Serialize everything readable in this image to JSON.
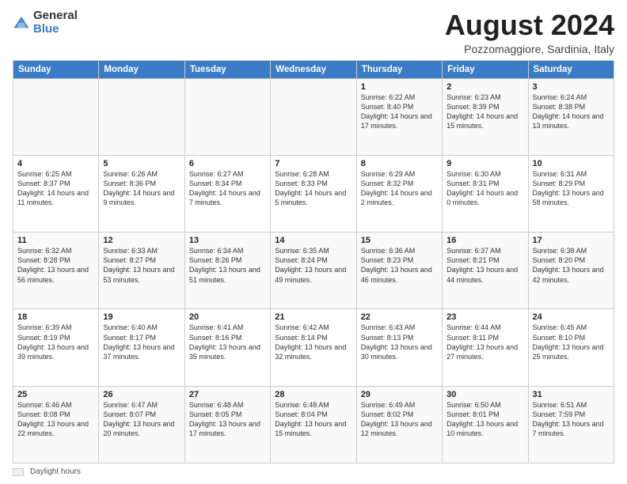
{
  "header": {
    "logo_general": "General",
    "logo_blue": "Blue",
    "month_title": "August 2024",
    "location": "Pozzomaggiore, Sardinia, Italy"
  },
  "footer": {
    "legend_label": "Daylight hours"
  },
  "days_of_week": [
    "Sunday",
    "Monday",
    "Tuesday",
    "Wednesday",
    "Thursday",
    "Friday",
    "Saturday"
  ],
  "weeks": [
    {
      "days": [
        {
          "num": "",
          "info": "",
          "empty": true
        },
        {
          "num": "",
          "info": "",
          "empty": true
        },
        {
          "num": "",
          "info": "",
          "empty": true
        },
        {
          "num": "",
          "info": "",
          "empty": true
        },
        {
          "num": "1",
          "info": "Sunrise: 6:22 AM\nSunset: 8:40 PM\nDaylight: 14 hours and 17 minutes."
        },
        {
          "num": "2",
          "info": "Sunrise: 6:23 AM\nSunset: 8:39 PM\nDaylight: 14 hours and 15 minutes."
        },
        {
          "num": "3",
          "info": "Sunrise: 6:24 AM\nSunset: 8:38 PM\nDaylight: 14 hours and 13 minutes."
        }
      ]
    },
    {
      "days": [
        {
          "num": "4",
          "info": "Sunrise: 6:25 AM\nSunset: 8:37 PM\nDaylight: 14 hours and 11 minutes."
        },
        {
          "num": "5",
          "info": "Sunrise: 6:26 AM\nSunset: 8:36 PM\nDaylight: 14 hours and 9 minutes."
        },
        {
          "num": "6",
          "info": "Sunrise: 6:27 AM\nSunset: 8:34 PM\nDaylight: 14 hours and 7 minutes."
        },
        {
          "num": "7",
          "info": "Sunrise: 6:28 AM\nSunset: 8:33 PM\nDaylight: 14 hours and 5 minutes."
        },
        {
          "num": "8",
          "info": "Sunrise: 6:29 AM\nSunset: 8:32 PM\nDaylight: 14 hours and 2 minutes."
        },
        {
          "num": "9",
          "info": "Sunrise: 6:30 AM\nSunset: 8:31 PM\nDaylight: 14 hours and 0 minutes."
        },
        {
          "num": "10",
          "info": "Sunrise: 6:31 AM\nSunset: 8:29 PM\nDaylight: 13 hours and 58 minutes."
        }
      ]
    },
    {
      "days": [
        {
          "num": "11",
          "info": "Sunrise: 6:32 AM\nSunset: 8:28 PM\nDaylight: 13 hours and 56 minutes."
        },
        {
          "num": "12",
          "info": "Sunrise: 6:33 AM\nSunset: 8:27 PM\nDaylight: 13 hours and 53 minutes."
        },
        {
          "num": "13",
          "info": "Sunrise: 6:34 AM\nSunset: 8:26 PM\nDaylight: 13 hours and 51 minutes."
        },
        {
          "num": "14",
          "info": "Sunrise: 6:35 AM\nSunset: 8:24 PM\nDaylight: 13 hours and 49 minutes."
        },
        {
          "num": "15",
          "info": "Sunrise: 6:36 AM\nSunset: 8:23 PM\nDaylight: 13 hours and 46 minutes."
        },
        {
          "num": "16",
          "info": "Sunrise: 6:37 AM\nSunset: 8:21 PM\nDaylight: 13 hours and 44 minutes."
        },
        {
          "num": "17",
          "info": "Sunrise: 6:38 AM\nSunset: 8:20 PM\nDaylight: 13 hours and 42 minutes."
        }
      ]
    },
    {
      "days": [
        {
          "num": "18",
          "info": "Sunrise: 6:39 AM\nSunset: 8:19 PM\nDaylight: 13 hours and 39 minutes."
        },
        {
          "num": "19",
          "info": "Sunrise: 6:40 AM\nSunset: 8:17 PM\nDaylight: 13 hours and 37 minutes."
        },
        {
          "num": "20",
          "info": "Sunrise: 6:41 AM\nSunset: 8:16 PM\nDaylight: 13 hours and 35 minutes."
        },
        {
          "num": "21",
          "info": "Sunrise: 6:42 AM\nSunset: 8:14 PM\nDaylight: 13 hours and 32 minutes."
        },
        {
          "num": "22",
          "info": "Sunrise: 6:43 AM\nSunset: 8:13 PM\nDaylight: 13 hours and 30 minutes."
        },
        {
          "num": "23",
          "info": "Sunrise: 6:44 AM\nSunset: 8:11 PM\nDaylight: 13 hours and 27 minutes."
        },
        {
          "num": "24",
          "info": "Sunrise: 6:45 AM\nSunset: 8:10 PM\nDaylight: 13 hours and 25 minutes."
        }
      ]
    },
    {
      "days": [
        {
          "num": "25",
          "info": "Sunrise: 6:46 AM\nSunset: 8:08 PM\nDaylight: 13 hours and 22 minutes."
        },
        {
          "num": "26",
          "info": "Sunrise: 6:47 AM\nSunset: 8:07 PM\nDaylight: 13 hours and 20 minutes."
        },
        {
          "num": "27",
          "info": "Sunrise: 6:48 AM\nSunset: 8:05 PM\nDaylight: 13 hours and 17 minutes."
        },
        {
          "num": "28",
          "info": "Sunrise: 6:48 AM\nSunset: 8:04 PM\nDaylight: 13 hours and 15 minutes."
        },
        {
          "num": "29",
          "info": "Sunrise: 6:49 AM\nSunset: 8:02 PM\nDaylight: 13 hours and 12 minutes."
        },
        {
          "num": "30",
          "info": "Sunrise: 6:50 AM\nSunset: 8:01 PM\nDaylight: 13 hours and 10 minutes."
        },
        {
          "num": "31",
          "info": "Sunrise: 6:51 AM\nSunset: 7:59 PM\nDaylight: 13 hours and 7 minutes."
        }
      ]
    }
  ]
}
